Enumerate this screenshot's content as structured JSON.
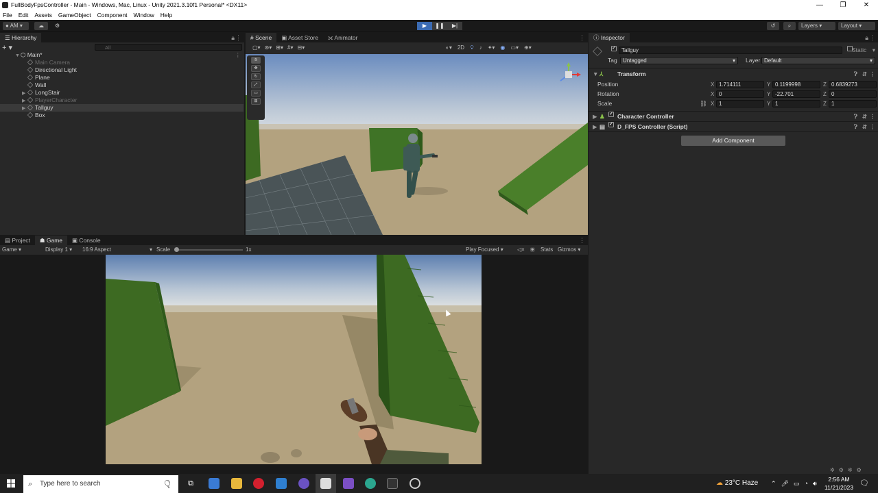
{
  "window": {
    "title": "FullBodyFpsController - Main - Windows, Mac, Linux - Unity 2021.3.10f1 Personal* <DX11>",
    "controls": [
      "—",
      "❐",
      "✕"
    ]
  },
  "menu": [
    "File",
    "Edit",
    "Assets",
    "GameObject",
    "Component",
    "Window",
    "Help"
  ],
  "toolbar": {
    "account": "AM",
    "layers": "Layers",
    "layout": "Layout"
  },
  "hierarchy": {
    "tab": "Hierarchy",
    "search_placeholder": "All",
    "scene": "Main*",
    "items": [
      {
        "label": "Main Camera",
        "dim": true
      },
      {
        "label": "Directional Light",
        "dim": false
      },
      {
        "label": "Plane",
        "dim": false
      },
      {
        "label": "Wall",
        "dim": false
      },
      {
        "label": "LongStair",
        "dim": false
      },
      {
        "label": "PlayerCharacter",
        "dim": true
      },
      {
        "label": "Tallguy",
        "dim": false
      },
      {
        "label": "Box",
        "dim": false
      }
    ]
  },
  "scene_tabs": [
    "Scene",
    "Asset Store",
    "Animator"
  ],
  "scene_toolbar": {
    "mode_2d": "2D"
  },
  "bottom_tabs": [
    "Project",
    "Game",
    "Console"
  ],
  "game_toolbar": {
    "view": "Game",
    "display": "Display 1",
    "aspect": "16:9 Aspect",
    "scale_label": "Scale",
    "scale_value": "1x",
    "play_mode": "Play Focused",
    "stats": "Stats",
    "gizmos": "Gizmos"
  },
  "inspector": {
    "tab": "Inspector",
    "object_name": "Tallguy",
    "static_label": "Static",
    "tag_label": "Tag",
    "tag_value": "Untagged",
    "layer_label": "Layer",
    "layer_value": "Default",
    "transform": {
      "title": "Transform",
      "position_label": "Position",
      "rotation_label": "Rotation",
      "scale_label": "Scale",
      "position": {
        "x": "1.714111",
        "y": "0.1199998",
        "z": "0.6839273"
      },
      "rotation": {
        "x": "0",
        "y": "-22.701",
        "z": "0"
      },
      "scale": {
        "x": "1",
        "y": "1",
        "z": "1"
      }
    },
    "components": [
      "Character Controller",
      "D_FPS Controller (Script)"
    ],
    "add_component": "Add Component"
  },
  "taskbar": {
    "search_placeholder": "Type here to search",
    "weather": "23°C  Haze",
    "time": "2:56 AM",
    "date": "11/21/2023"
  },
  "colors": {
    "accent": "#3b6bb3",
    "panel": "#282828",
    "ground": "#b3a27f",
    "sky_top": "#5d7fb0",
    "stairs": "#3d6a22"
  }
}
